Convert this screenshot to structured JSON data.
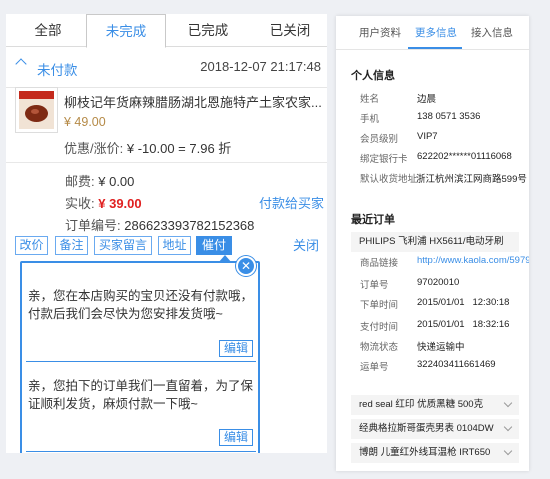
{
  "left": {
    "tabs": [
      "全部",
      "未完成",
      "已完成",
      "已关闭"
    ],
    "section": {
      "title": "未付款",
      "time": "2018-12-07 21:17:48"
    },
    "product": {
      "title": "柳枝记年货麻辣腊肠湖北恩施特产土家农家...",
      "price": "¥ 49.00",
      "discount_label": "优惠/涨价:",
      "discount_value": "¥ -10.00 = 7.96 折"
    },
    "summary": {
      "shipping_label": "邮费:",
      "shipping_value": "¥ 0.00",
      "paid_label": "实收:",
      "paid_value": "¥ 39.00",
      "pay_for_buyer": "付款给买家",
      "order_label": "订单编号:",
      "order_value": "286623393782152368"
    },
    "actions": [
      "改价",
      "备注",
      "买家留言",
      "地址",
      "催付"
    ],
    "close": "关闭",
    "popup": {
      "templates": [
        {
          "text": "亲，您在本店购买的宝贝还没有付款哦，付款后我们会尽快为您安排发货哦~",
          "edit": "编辑"
        },
        {
          "text": "亲，您拍下的订单我们一直留着，为了保证顺利发货，麻烦付款一下哦~",
          "edit": "编辑"
        }
      ]
    }
  },
  "right": {
    "tabs": [
      "用户资料",
      "更多信息",
      "接入信息"
    ],
    "personal": {
      "title": "个人信息",
      "rows": [
        {
          "label": "姓名",
          "value": "边晨"
        },
        {
          "label": "手机",
          "value": "138 0571 3536"
        },
        {
          "label": "会员级别",
          "value": "VIP7"
        },
        {
          "label": "绑定银行卡",
          "value": "622202******01116068"
        },
        {
          "label": "默认收货地址",
          "value": "浙江杭州滨江网商路599号"
        }
      ]
    },
    "orders": {
      "title": "最近订单",
      "first_product": "PHILIPS 飞利浦 HX5611/电动牙刷",
      "rows": [
        {
          "label": "商品链接",
          "value": "http://www.kaola.com/5979"
        },
        {
          "label": "订单号",
          "value": "97020010"
        },
        {
          "label": "下单时间",
          "value": "2015/01/01   12:30:18"
        },
        {
          "label": "支付时间",
          "value": "2015/01/01   18:32:16"
        },
        {
          "label": "物流状态",
          "value": "快递运输中"
        },
        {
          "label": "运单号",
          "value": "322403411661469"
        }
      ],
      "more": [
        "red seal 红印 优质黑糖 500克",
        "经典格拉斯哥蛋壳男表 0104DW",
        "博朗 儿童红外线耳温枪 IRT650"
      ]
    }
  }
}
